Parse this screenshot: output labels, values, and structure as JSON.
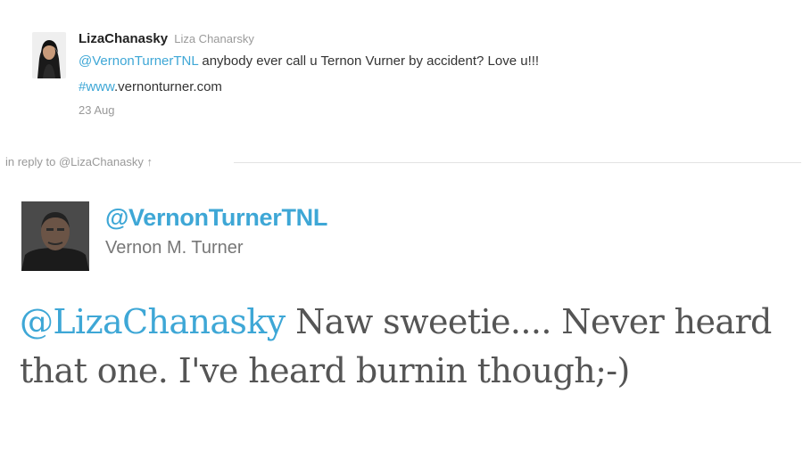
{
  "parent_tweet": {
    "screen_name": "LizaChanasky",
    "full_name": "Liza Chanarsky",
    "mention": "@VernonTurnerTNL",
    "text_after_mention": " anybody ever call u Ternon Vurner by accident? Love u!!!",
    "hashtag": "#www",
    "text_after_hashtag": ".vernonturner.com",
    "date": "23 Aug"
  },
  "reply_context": {
    "label": "in reply to @LizaChanasky",
    "arrow": "↑"
  },
  "main_tweet": {
    "screen_name": "@VernonTurnerTNL",
    "full_name": "Vernon M. Turner",
    "mention": "@LizaChanasky",
    "text": " Naw sweetie.... Never heard that one. I've heard burnin though;-)"
  },
  "colors": {
    "link": "#3ea7d6",
    "text": "#333333",
    "meta": "#999999"
  }
}
